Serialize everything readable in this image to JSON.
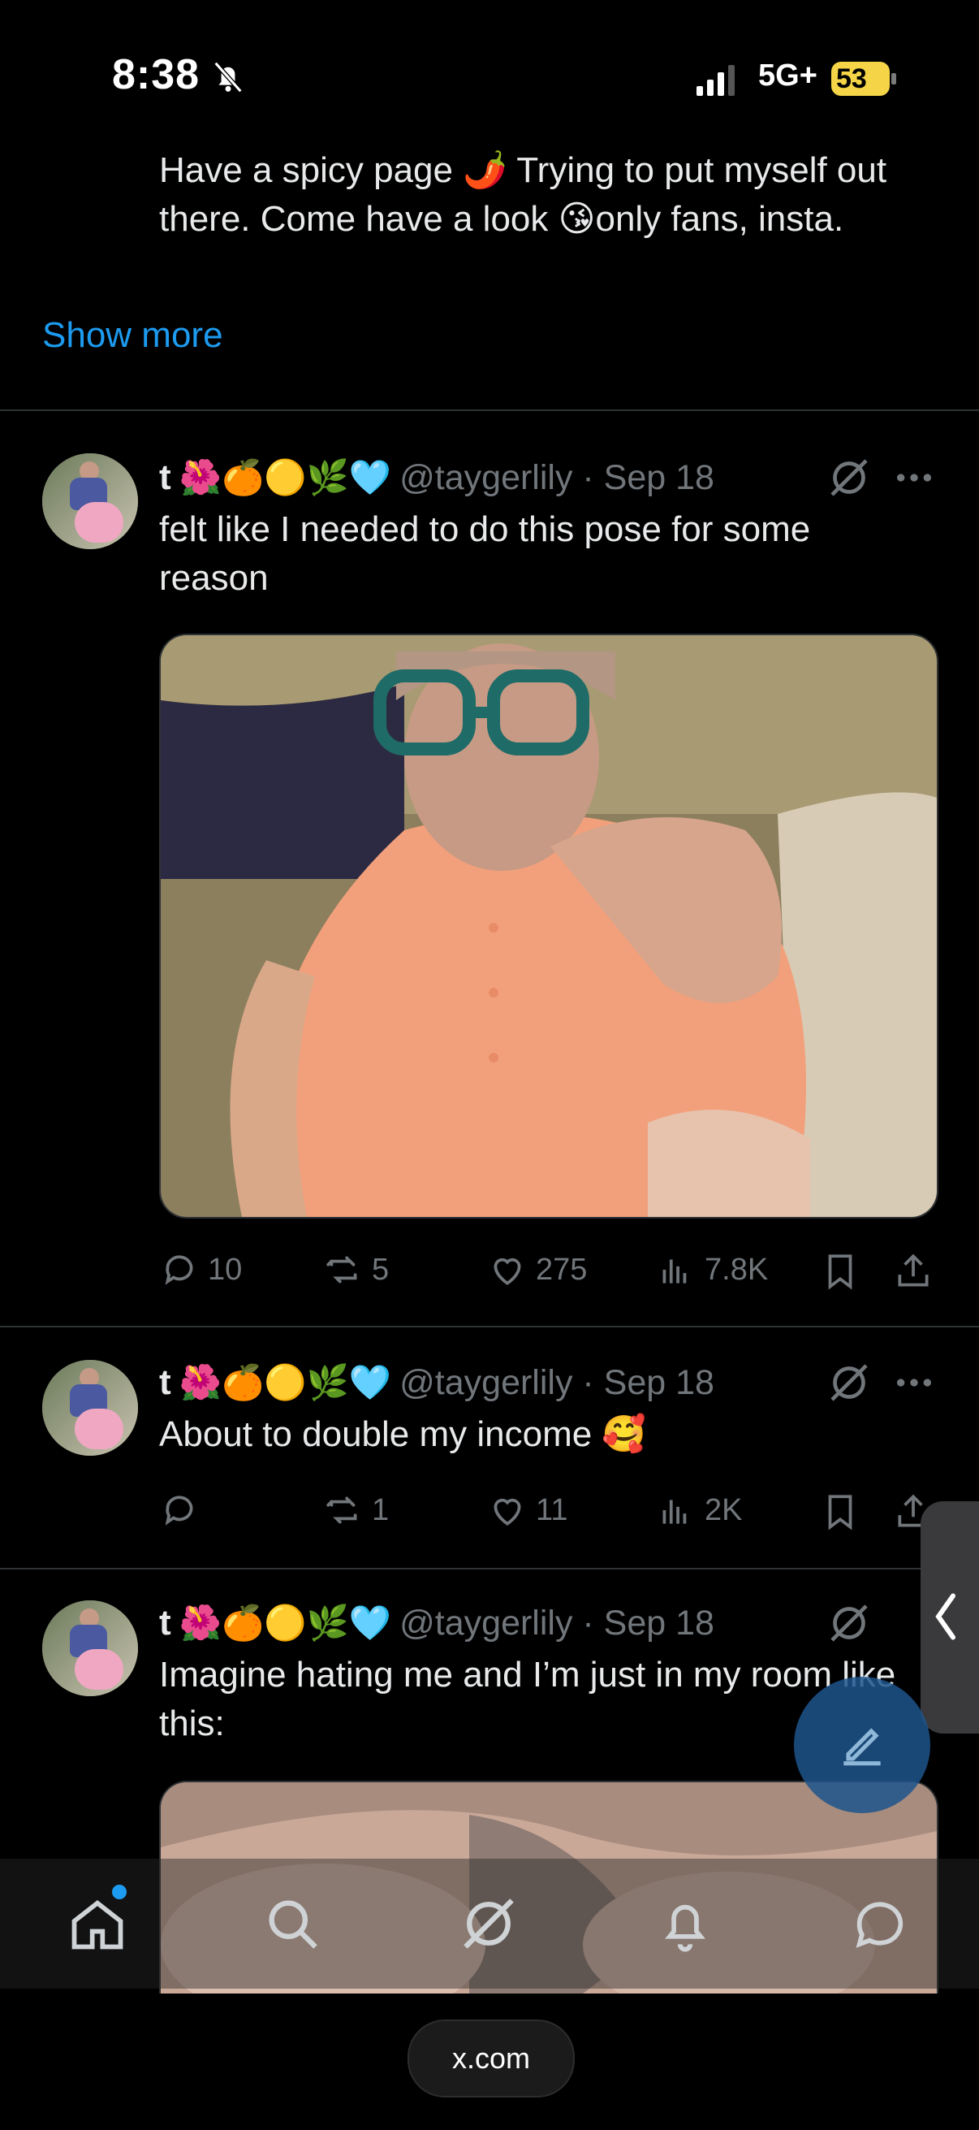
{
  "status_bar": {
    "time": "8:38",
    "network": "5G+",
    "battery": "53",
    "icons": [
      "bell-off-icon",
      "signal-icon",
      "battery-icon"
    ]
  },
  "bio": {
    "text_line1": "Have a spicy page 🌶️ Trying to put myself out",
    "text_line2": "there. Come have a look 😘only fans, insta."
  },
  "show_more": "Show more",
  "tweets": [
    {
      "name": "t",
      "emojis": "🌺🍊🟡🌿🩵",
      "handle": "@taygerlily · Sep 18",
      "text_line1": "felt like I needed to do this pose for some",
      "text_line2": "reason",
      "replies": "10",
      "reposts": "5",
      "likes": "275",
      "views": "7.8K"
    },
    {
      "name": "t",
      "emojis": "🌺🍊🟡🌿🩵",
      "handle": "@taygerlily · Sep 18",
      "text_line1": "About to double my income 🥰",
      "replies": "",
      "reposts": "1",
      "likes": "11",
      "views": "2K"
    },
    {
      "name": "t",
      "emojis": "🌺🍊🟡🌿🩵",
      "handle": "@taygerlily · Sep 18",
      "text_line1": "Imagine hating me and I’m just in my room like",
      "text_line2": "this:"
    }
  ],
  "bottom_nav": [
    "home-icon",
    "search-icon",
    "grok-icon",
    "notifications-icon",
    "messages-icon"
  ],
  "browser_url": "x.com",
  "colors": {
    "accent": "#1d9bf0",
    "text": "#e7e9ea",
    "muted": "#71767b",
    "divider": "#2f3336",
    "background": "#000000"
  }
}
